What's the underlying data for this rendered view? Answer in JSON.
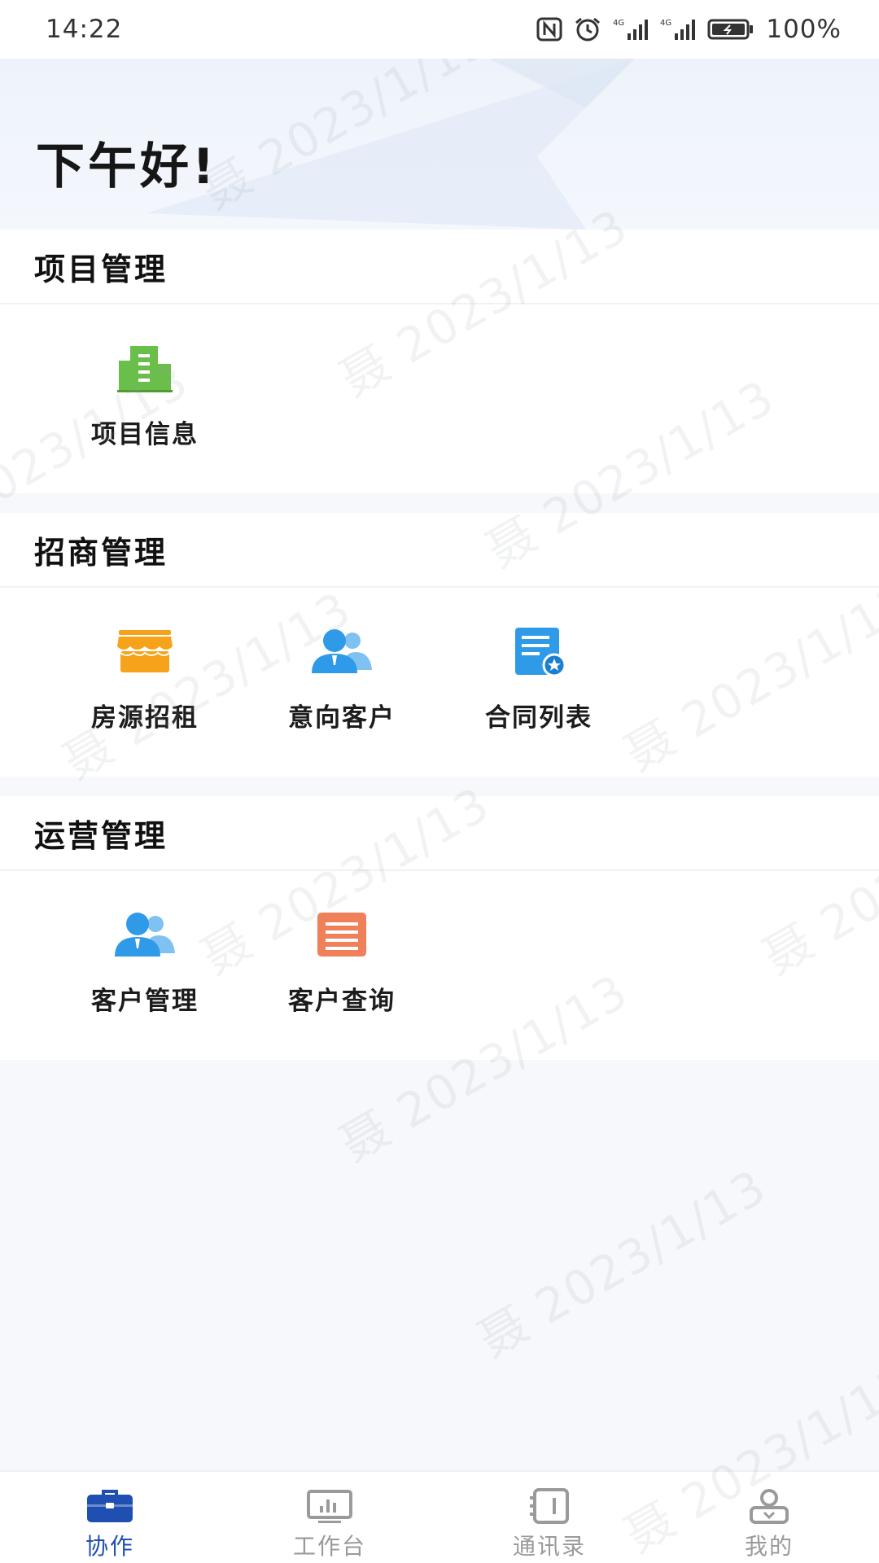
{
  "status_bar": {
    "time": "14:22",
    "battery_text": "100%",
    "icons": [
      "nfc-icon",
      "alarm-icon",
      "signal-4g-icon",
      "signal-4g-icon",
      "battery-icon"
    ]
  },
  "hero": {
    "greeting": "下午好!"
  },
  "sections": [
    {
      "title": "项目管理",
      "items": [
        {
          "label": "项目信息",
          "icon": "building-icon",
          "color": "#6abf4b"
        }
      ]
    },
    {
      "title": "招商管理",
      "items": [
        {
          "label": "房源招租",
          "icon": "storefront-icon",
          "color": "#f6a21a"
        },
        {
          "label": "意向客户",
          "icon": "people-icon",
          "color": "#2f9be8"
        },
        {
          "label": "合同列表",
          "icon": "contract-icon",
          "color": "#2f9be8"
        }
      ]
    },
    {
      "title": "运营管理",
      "items": [
        {
          "label": "客户管理",
          "icon": "people-icon",
          "color": "#2f9be8"
        },
        {
          "label": "客户查询",
          "icon": "document-list-icon",
          "color": "#f0805a"
        }
      ]
    }
  ],
  "watermark": "聂 2023/1/13",
  "tab_bar": {
    "active": "协作",
    "tabs": [
      {
        "label": "协作",
        "icon": "briefcase-icon"
      },
      {
        "label": "工作台",
        "icon": "monitor-chart-icon"
      },
      {
        "label": "通讯录",
        "icon": "address-book-icon"
      },
      {
        "label": "我的",
        "icon": "user-icon"
      }
    ]
  },
  "colors": {
    "accent": "#1f4fb0",
    "background": "#f6f8fb"
  }
}
